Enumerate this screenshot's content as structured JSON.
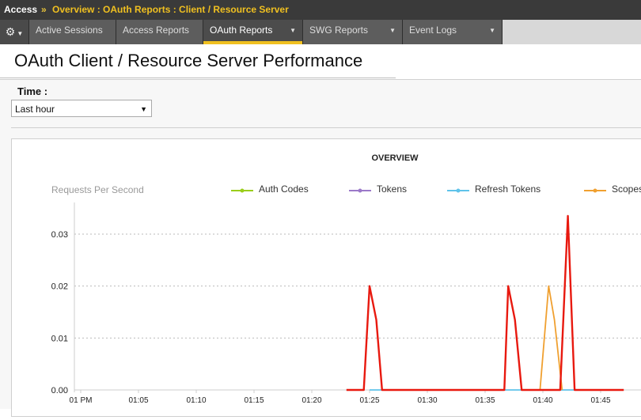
{
  "breadcrumb": {
    "root": "Access",
    "separator": "»",
    "path": "Overview : OAuth Reports : Client / Resource Server"
  },
  "nav": {
    "settings_icon": "gear-icon",
    "tabs": [
      {
        "label": "Active Sessions",
        "has_dropdown": false,
        "active": false
      },
      {
        "label": "Access Reports",
        "has_dropdown": false,
        "active": false
      },
      {
        "label": "OAuth Reports",
        "has_dropdown": true,
        "active": true
      },
      {
        "label": "SWG Reports",
        "has_dropdown": true,
        "active": false
      },
      {
        "label": "Event Logs",
        "has_dropdown": true,
        "active": false
      }
    ]
  },
  "page": {
    "title": "OAuth Client / Resource Server Performance"
  },
  "filter": {
    "time_label": "Time :",
    "time_value": "Last hour"
  },
  "colors": {
    "accent": "#f0c020",
    "auth_codes": "#9acd1a",
    "tokens": "#9b79c9",
    "refresh_tokens": "#5fc3ea",
    "scopes": "#f0a030",
    "failures": "#e8190f"
  },
  "chart_data": {
    "type": "line",
    "title": "OVERVIEW",
    "ylabel": "Requests Per Second",
    "xlabel": "",
    "ylim": [
      0,
      0.035
    ],
    "yticks": [
      "0.03",
      "0.02",
      "0.01",
      "0.00"
    ],
    "xticks": [
      "01 PM",
      "01:05",
      "01:10",
      "01:15",
      "01:20",
      "01:25",
      "01:30",
      "01:35",
      "01:40",
      "01:45"
    ],
    "grid": true,
    "legend_position": "top",
    "series": [
      {
        "name": "Auth Codes",
        "color": "#9acd1a",
        "points": []
      },
      {
        "name": "Tokens",
        "color": "#9b79c9",
        "points": []
      },
      {
        "name": "Refresh Tokens",
        "color": "#5fc3ea",
        "points": [
          [
            "01:25:00",
            0
          ],
          [
            "01:25:45",
            0
          ],
          [
            "01:37:00",
            0
          ],
          [
            "01:38:10",
            0
          ],
          [
            "01:42:10",
            0
          ],
          [
            "01:43:00",
            0
          ]
        ]
      },
      {
        "name": "Scopes",
        "color": "#f0a030",
        "points": [
          [
            "01:39:45",
            0
          ],
          [
            "01:40:30",
            0.02
          ],
          [
            "01:41:00",
            0.0135
          ],
          [
            "01:41:40",
            0
          ]
        ]
      },
      {
        "color": "#e8190f",
        "points": [
          [
            "01:23:00",
            0
          ],
          [
            "01:24:30",
            0
          ],
          [
            "01:25:00",
            0.02
          ],
          [
            "01:25:35",
            0.0135
          ],
          [
            "01:26:05",
            0
          ],
          [
            "01:36:40",
            0
          ],
          [
            "01:37:00",
            0.02
          ],
          [
            "01:37:35",
            0.0135
          ],
          [
            "01:38:10",
            0
          ],
          [
            "01:41:30",
            0
          ],
          [
            "01:42:10",
            0.0335
          ],
          [
            "01:42:45",
            0
          ],
          [
            "01:47:00",
            0
          ]
        ]
      }
    ]
  }
}
